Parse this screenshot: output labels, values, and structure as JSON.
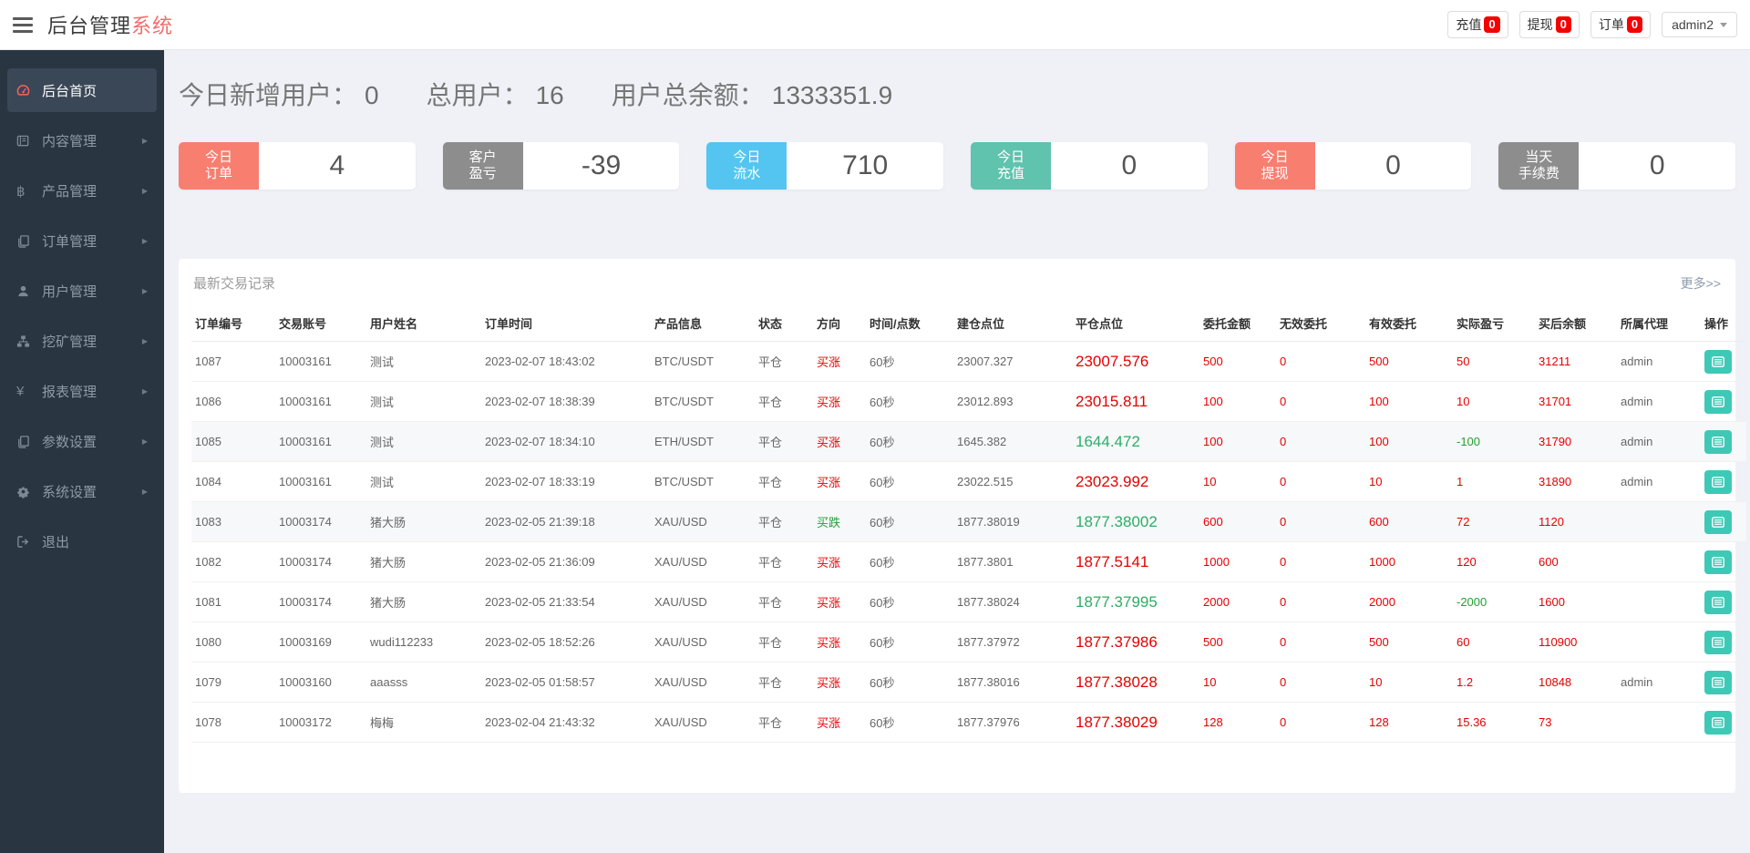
{
  "header": {
    "brand": {
      "part1": "后台管理",
      "part2": "系统"
    },
    "nav_buttons": [
      {
        "label": "充值",
        "badge": "0"
      },
      {
        "label": "提现",
        "badge": "0"
      },
      {
        "label": "订单",
        "badge": "0"
      }
    ],
    "user_menu": {
      "label": "admin2"
    }
  },
  "sidebar": {
    "items": [
      {
        "label": "后台首页",
        "icon": "dashboard-icon",
        "active": true
      },
      {
        "label": "内容管理",
        "icon": "book-icon"
      },
      {
        "label": "产品管理",
        "icon": "bitcoin-icon"
      },
      {
        "label": "订单管理",
        "icon": "orders-copy-icon"
      },
      {
        "label": "用户管理",
        "icon": "user-icon"
      },
      {
        "label": "挖矿管理",
        "icon": "mining-sitemap-icon"
      },
      {
        "label": "报表管理",
        "icon": "yen-icon"
      },
      {
        "label": "参数设置",
        "icon": "params-copy-icon"
      },
      {
        "label": "系统设置",
        "icon": "gear-icon"
      },
      {
        "label": "退出",
        "icon": "logout-icon"
      }
    ]
  },
  "overview": {
    "stats": [
      {
        "label": "今日新增用户：",
        "value": "0"
      },
      {
        "label": "总用户：",
        "value": "16"
      },
      {
        "label": "用户总余额：",
        "value": "1333351.9"
      }
    ],
    "cards": [
      {
        "lines": [
          "今日",
          "订单"
        ],
        "value": "4",
        "color": "#f87e70"
      },
      {
        "lines": [
          "客户",
          "盈亏"
        ],
        "value": "-39",
        "color": "#8d8d8d"
      },
      {
        "lines": [
          "今日",
          "流水"
        ],
        "value": "710",
        "color": "#54c5f0"
      },
      {
        "lines": [
          "今日",
          "充值"
        ],
        "value": "0",
        "color": "#5fc3ae"
      },
      {
        "lines": [
          "今日",
          "提现"
        ],
        "value": "0",
        "color": "#f87e70"
      },
      {
        "lines": [
          "当天",
          "手续费"
        ],
        "value": "0",
        "color": "#8d8d8d"
      }
    ]
  },
  "panel": {
    "title": "最新交易记录",
    "more_link": "更多>>",
    "table": {
      "columns": [
        "订单编号",
        "交易账号",
        "用户姓名",
        "订单时间",
        "产品信息",
        "状态",
        "方向",
        "时间/点数",
        "建仓点位",
        "平仓点位",
        "委托金额",
        "无效委托",
        "有效委托",
        "实际盈亏",
        "买后余额",
        "所属代理",
        "操作"
      ],
      "rows": [
        {
          "id": "1087",
          "account": "10003161",
          "name": "测试",
          "time": "2023-02-07 18:43:02",
          "product": "BTC/USDT",
          "status": "平仓",
          "direction": "买涨",
          "period": "60秒",
          "open": "23007.327",
          "close": "23007.576",
          "amount": "500",
          "invalid": "0",
          "valid": "500",
          "profit": "50",
          "balance": "31211",
          "agent": "admin"
        },
        {
          "id": "1086",
          "account": "10003161",
          "name": "测试",
          "time": "2023-02-07 18:38:39",
          "product": "BTC/USDT",
          "status": "平仓",
          "direction": "买涨",
          "period": "60秒",
          "open": "23012.893",
          "close": "23015.811",
          "amount": "100",
          "invalid": "0",
          "valid": "100",
          "profit": "10",
          "balance": "31701",
          "agent": "admin"
        },
        {
          "id": "1085",
          "account": "10003161",
          "name": "测试",
          "time": "2023-02-07 18:34:10",
          "product": "ETH/USDT",
          "status": "平仓",
          "direction": "买涨",
          "period": "60秒",
          "open": "1645.382",
          "close": "1644.472",
          "amount": "100",
          "invalid": "0",
          "valid": "100",
          "profit": "-100",
          "balance": "31790",
          "agent": "admin"
        },
        {
          "id": "1084",
          "account": "10003161",
          "name": "测试",
          "time": "2023-02-07 18:33:19",
          "product": "BTC/USDT",
          "status": "平仓",
          "direction": "买涨",
          "period": "60秒",
          "open": "23022.515",
          "close": "23023.992",
          "amount": "10",
          "invalid": "0",
          "valid": "10",
          "profit": "1",
          "balance": "31890",
          "agent": "admin"
        },
        {
          "id": "1083",
          "account": "10003174",
          "name": "猪大肠",
          "time": "2023-02-05 21:39:18",
          "product": "XAU/USD",
          "status": "平仓",
          "direction": "买跌",
          "period": "60秒",
          "open": "1877.38019",
          "close": "1877.38002",
          "amount": "600",
          "invalid": "0",
          "valid": "600",
          "profit": "72",
          "balance": "1120",
          "agent": ""
        },
        {
          "id": "1082",
          "account": "10003174",
          "name": "猪大肠",
          "time": "2023-02-05 21:36:09",
          "product": "XAU/USD",
          "status": "平仓",
          "direction": "买涨",
          "period": "60秒",
          "open": "1877.3801",
          "close": "1877.5141",
          "amount": "1000",
          "invalid": "0",
          "valid": "1000",
          "profit": "120",
          "balance": "600",
          "agent": ""
        },
        {
          "id": "1081",
          "account": "10003174",
          "name": "猪大肠",
          "time": "2023-02-05 21:33:54",
          "product": "XAU/USD",
          "status": "平仓",
          "direction": "买涨",
          "period": "60秒",
          "open": "1877.38024",
          "close": "1877.37995",
          "amount": "2000",
          "invalid": "0",
          "valid": "2000",
          "profit": "-2000",
          "balance": "1600",
          "agent": ""
        },
        {
          "id": "1080",
          "account": "10003169",
          "name": "wudi112233",
          "time": "2023-02-05 18:52:26",
          "product": "XAU/USD",
          "status": "平仓",
          "direction": "买涨",
          "period": "60秒",
          "open": "1877.37972",
          "close": "1877.37986",
          "amount": "500",
          "invalid": "0",
          "valid": "500",
          "profit": "60",
          "balance": "110900",
          "agent": ""
        },
        {
          "id": "1079",
          "account": "10003160",
          "name": "aaasss",
          "time": "2023-02-05 01:58:57",
          "product": "XAU/USD",
          "status": "平仓",
          "direction": "买涨",
          "period": "60秒",
          "open": "1877.38016",
          "close": "1877.38028",
          "amount": "10",
          "invalid": "0",
          "valid": "10",
          "profit": "1.2",
          "balance": "10848",
          "agent": "admin"
        },
        {
          "id": "1078",
          "account": "10003172",
          "name": "梅梅",
          "time": "2023-02-04 21:43:32",
          "product": "XAU/USD",
          "status": "平仓",
          "direction": "买涨",
          "period": "60秒",
          "open": "1877.37976",
          "close": "1877.38029",
          "amount": "128",
          "invalid": "0",
          "valid": "128",
          "profit": "15.36",
          "balance": "73",
          "agent": ""
        }
      ]
    }
  },
  "colors": {
    "sidebar_bg": "#2a3542",
    "brand_accent": "#f56c6c",
    "badge_red": "#f50000",
    "up_red": "#e60000",
    "down_green": "#21a135",
    "price_green": "#2bae66",
    "action_teal": "#3ec9b6"
  }
}
